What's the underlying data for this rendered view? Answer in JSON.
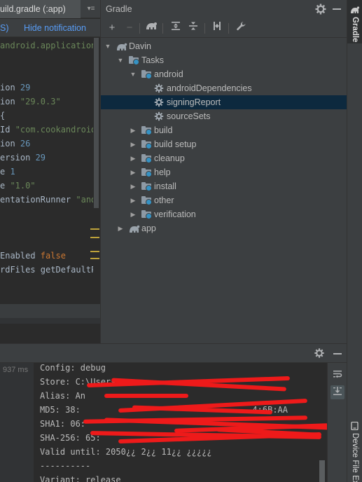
{
  "editor": {
    "tab_title": "uild.gradle (:app)",
    "tab_menu": "▾≡",
    "notif_left": "S)",
    "notif_hide": "Hide notification",
    "code_lines": [
      [
        {
          "t": "android.application",
          "c": "str"
        }
      ],
      [],
      [],
      [
        {
          "t": "ion ",
          "c": ""
        },
        {
          "t": "29",
          "c": "num"
        }
      ],
      [
        {
          "t": "ion ",
          "c": ""
        },
        {
          "t": "\"29.0.3\"",
          "c": "str"
        }
      ],
      [
        {
          "t": "{",
          "c": ""
        }
      ],
      [
        {
          "t": "Id ",
          "c": ""
        },
        {
          "t": "\"com.cookandroid.",
          "c": "str"
        }
      ],
      [
        {
          "t": "ion ",
          "c": ""
        },
        {
          "t": "26",
          "c": "num"
        }
      ],
      [
        {
          "t": "ersion ",
          "c": ""
        },
        {
          "t": "29",
          "c": "num"
        }
      ],
      [
        {
          "t": "e ",
          "c": ""
        },
        {
          "t": "1",
          "c": "num"
        }
      ],
      [
        {
          "t": "e ",
          "c": ""
        },
        {
          "t": "\"1.0\"",
          "c": "str"
        }
      ],
      [
        {
          "t": "entationRunner ",
          "c": ""
        },
        {
          "t": "\"andr",
          "c": "str"
        }
      ],
      [],
      [],
      [],
      [
        {
          "t": "Enabled ",
          "c": ""
        },
        {
          "t": "false",
          "c": "kw"
        }
      ],
      [
        {
          "t": "rdFiles getDefaultPro",
          "c": ""
        }
      ]
    ]
  },
  "gradle": {
    "title": "Gradle",
    "toolbar": [
      "+",
      "−",
      "",
      "",
      "",
      "",
      "",
      ""
    ],
    "tree": [
      {
        "label": "Davin",
        "level": 0,
        "arrow": "down",
        "icon": "elephant-icon"
      },
      {
        "label": "Tasks",
        "level": 1,
        "arrow": "down",
        "icon": "folder-icon"
      },
      {
        "label": "android",
        "level": 2,
        "arrow": "down",
        "icon": "folder-icon"
      },
      {
        "label": "androidDependencies",
        "level": 3,
        "arrow": "",
        "icon": "gear-icon"
      },
      {
        "label": "signingReport",
        "level": 3,
        "arrow": "",
        "icon": "gear-icon",
        "selected": true
      },
      {
        "label": "sourceSets",
        "level": 3,
        "arrow": "",
        "icon": "gear-icon"
      },
      {
        "label": "build",
        "level": 2,
        "arrow": "right",
        "icon": "folder-icon"
      },
      {
        "label": "build setup",
        "level": 2,
        "arrow": "right",
        "icon": "folder-icon"
      },
      {
        "label": "cleanup",
        "level": 2,
        "arrow": "right",
        "icon": "folder-icon"
      },
      {
        "label": "help",
        "level": 2,
        "arrow": "right",
        "icon": "folder-icon"
      },
      {
        "label": "install",
        "level": 2,
        "arrow": "right",
        "icon": "folder-icon"
      },
      {
        "label": "other",
        "level": 2,
        "arrow": "right",
        "icon": "folder-icon"
      },
      {
        "label": "verification",
        "level": 2,
        "arrow": "right",
        "icon": "folder-icon"
      },
      {
        "label": "app",
        "level": 1,
        "arrow": "right",
        "icon": "elephant-icon"
      }
    ]
  },
  "right_strip": {
    "gradle": "Gradle",
    "device_file": "Device File Ex"
  },
  "build": {
    "time": "937 ms",
    "console_lines": [
      "Config: debug",
      "Store: C:\\Users\\          ",
      "Alias: An                ",
      "MD5: 38:                                  4:6B:AA",
      "SHA1: 06:                                         ",
      "SHA-256: 65:                                      ",
      "Valid until: 2050¿¿ 2¿¿ 11¿¿ ¿¿¿¿¿",
      "----------",
      "Variant: release"
    ]
  },
  "colors": {
    "accent": "#589df6",
    "selection": "#0d293e",
    "redaction": "#ee1a1a"
  }
}
